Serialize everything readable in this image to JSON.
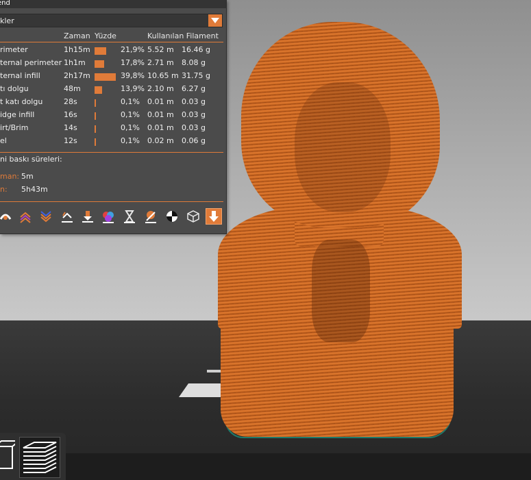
{
  "legend": {
    "title": "end",
    "combo_value": "kler",
    "headers": {
      "time": "Zaman",
      "percent": "Yüzde",
      "filament": "Kullanılan Filament"
    },
    "rows": [
      {
        "name": "rimeter",
        "time": "1h15m",
        "percent": "21,9%",
        "length": "5.52 m",
        "weight": "16.46 g",
        "share": 0.219
      },
      {
        "name": "ternal perimeter",
        "time": "1h1m",
        "percent": "17,8%",
        "length": "2.71 m",
        "weight": "8.08 g",
        "share": 0.178
      },
      {
        "name": "ternal infill",
        "time": "2h17m",
        "percent": "39,8%",
        "length": "10.65 m",
        "weight": "31.75 g",
        "share": 0.398
      },
      {
        "name": "tı dolgu",
        "time": "48m",
        "percent": "13,9%",
        "length": "2.10 m",
        "weight": "6.27 g",
        "share": 0.139
      },
      {
        "name": "t katı dolgu",
        "time": "28s",
        "percent": "0,1%",
        "length": "0.01 m",
        "weight": "0.03 g",
        "share": 0.001
      },
      {
        "name": "idge infill",
        "time": "16s",
        "percent": "0,1%",
        "length": "0.01 m",
        "weight": "0.03 g",
        "share": 0.001
      },
      {
        "name": "irt/Brim",
        "time": "14s",
        "percent": "0,1%",
        "length": "0.01 m",
        "weight": "0.03 g",
        "share": 0.001
      },
      {
        "name": "el",
        "time": "12s",
        "percent": "0,1%",
        "length": "0.02 m",
        "weight": "0.06 g",
        "share": 0.001
      }
    ],
    "estimates_title": "ni baskı süreleri:",
    "estimates": [
      {
        "label": "man:",
        "value": "5m"
      },
      {
        "label": "n:",
        "value": "5h43m"
      }
    ],
    "toolbar": [
      {
        "icon": "travel-icon"
      },
      {
        "icon": "wipe-icon"
      },
      {
        "icon": "retractions-icon"
      },
      {
        "icon": "deretractions-icon"
      },
      {
        "icon": "seams-icon"
      },
      {
        "icon": "tool-changes-icon"
      },
      {
        "icon": "color-changes-icon"
      },
      {
        "icon": "pause-icon"
      },
      {
        "icon": "custom-gcode-icon"
      },
      {
        "icon": "center-of-gravity-icon"
      },
      {
        "icon": "shells-icon"
      },
      {
        "icon": "tool-marker-icon"
      }
    ]
  },
  "view_buttons": [
    {
      "icon": "3d-view-icon"
    },
    {
      "icon": "preview-layers-icon"
    }
  ],
  "colors": {
    "accent": "#e07b39",
    "panel": "#4b4b4b",
    "model": "#c8651f"
  }
}
